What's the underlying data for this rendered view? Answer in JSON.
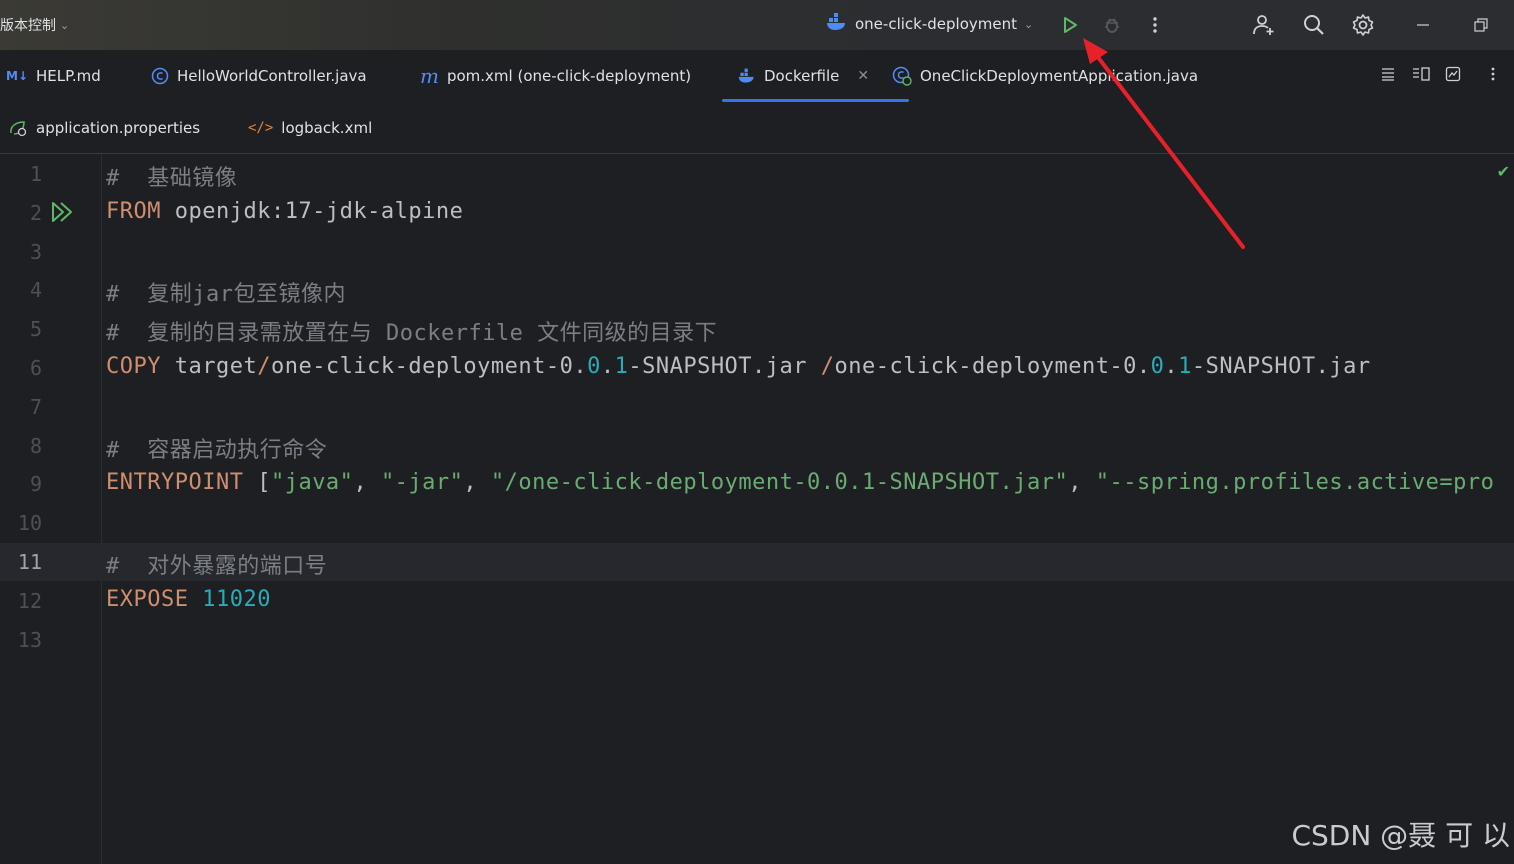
{
  "topbar": {
    "vcs_label": "版本控制",
    "run_config": "one-click-deployment"
  },
  "tabs": [
    {
      "label": "HELP.md",
      "badge": "M↓"
    },
    {
      "label": "HelloWorldController.java"
    },
    {
      "label": "pom.xml (one-click-deployment)"
    },
    {
      "label": "Dockerfile",
      "active": true
    },
    {
      "label": "OneClickDeploymentApplication.java"
    }
  ],
  "tabs_row2": [
    {
      "label": "application.properties"
    },
    {
      "label": "logback.xml"
    }
  ],
  "editor": {
    "line_numbers": [
      "1",
      "2",
      "3",
      "4",
      "5",
      "6",
      "7",
      "8",
      "9",
      "10",
      "11",
      "12",
      "13"
    ],
    "current_line": "11",
    "lines": [
      {
        "tokens": [
          {
            "t": "#  基础镜像",
            "c": "cm"
          }
        ]
      },
      {
        "tokens": [
          {
            "t": "FROM",
            "c": "kw"
          },
          {
            "t": " openjdk:17-jdk-alpine",
            "c": ""
          }
        ]
      },
      {
        "tokens": []
      },
      {
        "tokens": [
          {
            "t": "#  复制jar包至镜像内",
            "c": "cm"
          }
        ]
      },
      {
        "tokens": [
          {
            "t": "#  复制的目录需放置在与 Dockerfile 文件同级的目录下",
            "c": "cm"
          }
        ]
      },
      {
        "tokens": [
          {
            "t": "COPY",
            "c": "kw"
          },
          {
            "t": " target",
            "c": ""
          },
          {
            "t": "/",
            "c": "kw"
          },
          {
            "t": "one-click-deployment-0.",
            "c": ""
          },
          {
            "t": "0",
            "c": "num"
          },
          {
            "t": ".",
            "c": ""
          },
          {
            "t": "1",
            "c": "num"
          },
          {
            "t": "-SNAPSHOT.jar ",
            "c": ""
          },
          {
            "t": "/",
            "c": "kw"
          },
          {
            "t": "one-click-deployment-0.",
            "c": ""
          },
          {
            "t": "0",
            "c": "num"
          },
          {
            "t": ".",
            "c": ""
          },
          {
            "t": "1",
            "c": "num"
          },
          {
            "t": "-SNAPSHOT.jar",
            "c": ""
          }
        ]
      },
      {
        "tokens": []
      },
      {
        "tokens": [
          {
            "t": "#  容器启动执行命令",
            "c": "cm"
          }
        ]
      },
      {
        "tokens": [
          {
            "t": "ENTRYPOINT",
            "c": "kw"
          },
          {
            "t": " [",
            "c": ""
          },
          {
            "t": "\"java\"",
            "c": "str"
          },
          {
            "t": ", ",
            "c": ""
          },
          {
            "t": "\"-jar\"",
            "c": "str"
          },
          {
            "t": ", ",
            "c": ""
          },
          {
            "t": "\"/one-click-deployment-0.0.1-SNAPSHOT.jar\"",
            "c": "str"
          },
          {
            "t": ", ",
            "c": ""
          },
          {
            "t": "\"--spring.profiles.active=pro",
            "c": "str"
          }
        ]
      },
      {
        "tokens": []
      },
      {
        "tokens": [
          {
            "t": "#  对外暴露的端口号",
            "c": "cm"
          }
        ]
      },
      {
        "tokens": [
          {
            "t": "EXPOSE",
            "c": "kw"
          },
          {
            "t": " ",
            "c": ""
          },
          {
            "t": "11020",
            "c": "num"
          }
        ]
      },
      {
        "tokens": []
      }
    ]
  },
  "watermark": "CSDN @聂 可 以",
  "colors": {
    "keyword": "#cf8e6d",
    "comment": "#7a7e85",
    "number": "#2aacb8",
    "string": "#6aab73",
    "accent": "#3574f0",
    "run_green": "#5fb865",
    "annotation_arrow": "#e8202a"
  }
}
